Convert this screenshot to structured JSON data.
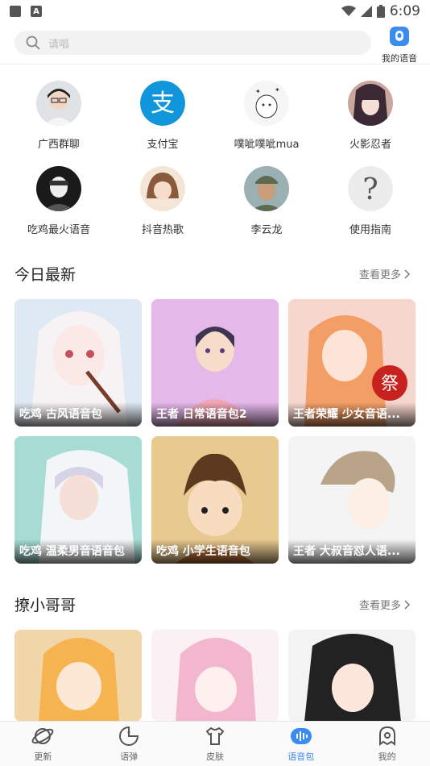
{
  "status_bar": {
    "time": "6:09"
  },
  "header": {
    "search_placeholder": "请唱",
    "my_voice_label": "我的语音"
  },
  "contacts": [
    {
      "name": "广西群聊",
      "icon": "person-avatar"
    },
    {
      "name": "支付宝",
      "icon": "alipay-logo"
    },
    {
      "name": "噗呲噗呲mua",
      "icon": "bear-avatar"
    },
    {
      "name": "火影忍者",
      "icon": "anime-girl-avatar"
    },
    {
      "name": "吃鸡最火语音",
      "icon": "soldier-avatar"
    },
    {
      "name": "抖音热歌",
      "icon": "girl-avatar"
    },
    {
      "name": "李云龙",
      "icon": "soldier-portrait-avatar"
    },
    {
      "name": "使用指南",
      "icon": "question-mark"
    }
  ],
  "sections": [
    {
      "title": "今日最新",
      "more_label": "查看更多",
      "cards": [
        {
          "caption": "吃鸡 古风语音包",
          "bg": "#e9dfe3"
        },
        {
          "caption": "王者 日常语音包2",
          "bg": "#e3b6e6"
        },
        {
          "caption": "王者荣耀 少女音语...",
          "bg": "#f1c3b4"
        },
        {
          "caption": "吃鸡 温柔男音语音包",
          "bg": "#bfe7df"
        },
        {
          "caption": "吃鸡 小学生语音包",
          "bg": "#e8c98f"
        },
        {
          "caption": "王者 大叔音怼人语...",
          "bg": "#f5f5f5"
        }
      ]
    },
    {
      "title": "撩小哥哥",
      "more_label": "查看更多",
      "cards": [
        {
          "caption": "",
          "bg": "#f7d9a8"
        },
        {
          "caption": "",
          "bg": "#f8e6ee"
        },
        {
          "caption": "",
          "bg": "#f3f3f3"
        }
      ]
    }
  ],
  "tabs": [
    {
      "label": "更新",
      "icon": "planet-icon",
      "active": false
    },
    {
      "label": "语弹",
      "icon": "pacman-icon",
      "active": false
    },
    {
      "label": "皮肤",
      "icon": "tshirt-icon",
      "active": false
    },
    {
      "label": "语音包",
      "icon": "voice-wave-icon",
      "active": true
    },
    {
      "label": "我的",
      "icon": "ghost-icon",
      "active": false
    }
  ],
  "colors": {
    "accent": "#3b8cf2",
    "alipay": "#1296db"
  }
}
